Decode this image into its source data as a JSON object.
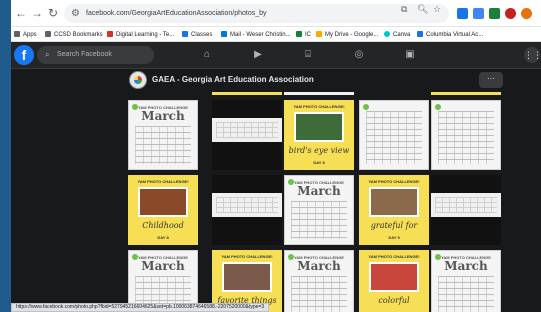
{
  "browser": {
    "url": "facebook.com/GeorgiaArtEducationAssociation/photos_by",
    "status_url": "https://www.facebook.com/photo.php?fbid=527945216604625&set=pb.100063874646588.-2207520000&type=3"
  },
  "bookmarks": [
    {
      "label": "Apps",
      "color": "#5f6368"
    },
    {
      "label": "CCSD Bookmarks",
      "color": "#5f6368"
    },
    {
      "label": "Digital Learning - Te...",
      "color": "#d93025"
    },
    {
      "label": "Classes",
      "color": "#1a73e8"
    },
    {
      "label": "Mail - Weser Christin...",
      "color": "#0078d4"
    },
    {
      "label": "IC",
      "color": "#188038"
    },
    {
      "label": "My Drive - Google...",
      "color": "#f9ab00"
    },
    {
      "label": "Canva",
      "color": "#00c4cc"
    },
    {
      "label": "Columbia Virtual Ac...",
      "color": "#1a73e8"
    }
  ],
  "facebook": {
    "logo": "f",
    "search_placeholder": "Search Facebook",
    "nav_icons": [
      "home-icon",
      "watch-icon",
      "marketplace-icon",
      "groups-icon",
      "gaming-icon"
    ]
  },
  "group": {
    "name": "GAEA - Georgia Art Education Association",
    "more_label": "···"
  },
  "tiles": {
    "calendar_heading": "YAM PHOTO CHALLENGE",
    "month": "March",
    "challenge_heading": "YAM PHOTO CHALLENGE!",
    "challenge_day_tag": "#YAMGEA",
    "items": [
      {
        "caption": "bird's eye view",
        "day": "DAY 8",
        "photo": "#3f6b3a"
      },
      {
        "caption": "Childhood",
        "day": "DAY 8",
        "photo": "#8a4a2a"
      },
      {
        "caption": "grateful for",
        "day": "DAY 9",
        "photo": "#8a6a4a"
      },
      {
        "caption": "favorite things",
        "day": "DAY 10",
        "photo": "#7a5a4a"
      },
      {
        "caption": "colorful",
        "day": "DAY 11",
        "photo": "#c9463d"
      }
    ]
  }
}
